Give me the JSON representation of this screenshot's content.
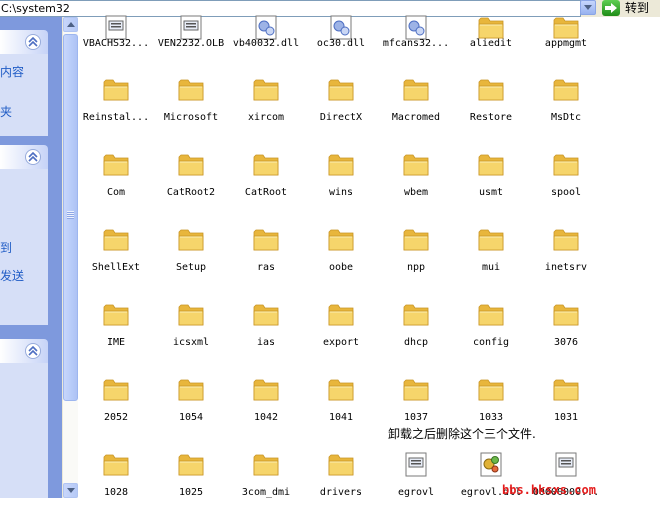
{
  "address_bar": {
    "path": "C:\\system32",
    "go_label": "转到"
  },
  "left_pane": {
    "panel1_links": [
      "内容",
      "夹"
    ],
    "panel2_links": [
      "到",
      "发送"
    ]
  },
  "files": {
    "top_row": [
      "VBACHS32...",
      "VEN2232.OLB",
      "vb40032.dll",
      "oc30.dll",
      "mfcans32...",
      "aliedit",
      "appmgmt"
    ],
    "rows": [
      [
        "Reinstal...",
        "Microsoft",
        "xircom",
        "DirectX",
        "Macromed",
        "Restore",
        "MsDtc"
      ],
      [
        "Com",
        "CatRoot2",
        "CatRoot",
        "wins",
        "wbem",
        "usmt",
        "spool"
      ],
      [
        "ShellExt",
        "Setup",
        "ras",
        "oobe",
        "npp",
        "mui",
        "inetsrv"
      ],
      [
        "IME",
        "icsxml",
        "ias",
        "export",
        "dhcp",
        "config",
        "3076"
      ],
      [
        "2052",
        "1054",
        "1042",
        "1041",
        "1037",
        "1033",
        "1031"
      ],
      [
        "1028",
        "1025",
        "3com_dmi",
        "drivers",
        "egrovl",
        "egrovl.dll",
        "00000000..."
      ]
    ]
  },
  "note": "卸载之后删除这个三个文件.",
  "watermark": "bbs.hksxs.com",
  "colors": {
    "task_pane_bg": "#7e99dd",
    "link_color": "#215dc6",
    "folder_yellow": "#f6d56b",
    "go_green": "#2fa524",
    "watermark_red": "#e41b1b"
  }
}
